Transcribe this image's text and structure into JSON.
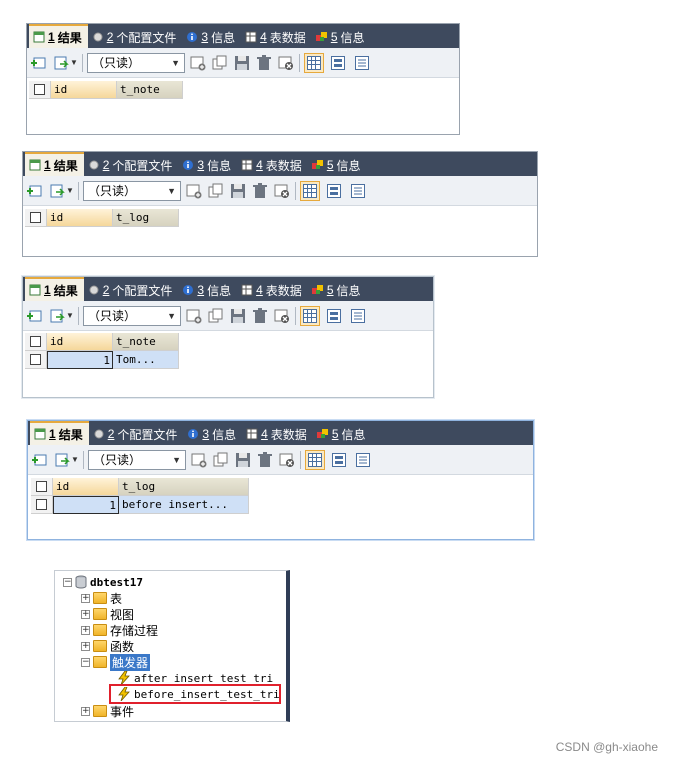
{
  "tabs": [
    {
      "num": "1",
      "label": "结果",
      "icon": "result-grid-icon",
      "active": true
    },
    {
      "num": "2",
      "label": "个配置文件",
      "icon": "profile-icon",
      "active": false
    },
    {
      "num": "3",
      "label": "信息",
      "icon": "info-icon",
      "active": false
    },
    {
      "num": "4",
      "label": "表数据",
      "icon": "table-data-icon",
      "active": false
    },
    {
      "num": "5",
      "label": "信息",
      "icon": "info-2-icon",
      "active": false
    }
  ],
  "toolbar": {
    "read_mode": "（只读）"
  },
  "screens": [
    {
      "columns": [
        "id",
        "t_note"
      ],
      "rows": []
    },
    {
      "columns": [
        "id",
        "t_log"
      ],
      "rows": []
    },
    {
      "columns": [
        "id",
        "t_note"
      ],
      "rows": [
        [
          "1",
          "Tom..."
        ]
      ]
    },
    {
      "columns": [
        "id",
        "t_log"
      ],
      "rows": [
        [
          "1",
          "before insert..."
        ]
      ]
    }
  ],
  "tree": {
    "database": "dbtest17",
    "items": [
      "表",
      "视图",
      "存储过程",
      "函数",
      "触发器",
      "事件"
    ],
    "triggers": [
      "after_insert_test_tri",
      "before_insert_test_tri"
    ]
  },
  "colors": {
    "tab_bg": "#3e4a5e",
    "active_tab_accent": "#e6a93d",
    "selection": "#cfe0f6",
    "highlight_box": "#e0202c"
  },
  "watermark": "CSDN @gh-xiaohe"
}
